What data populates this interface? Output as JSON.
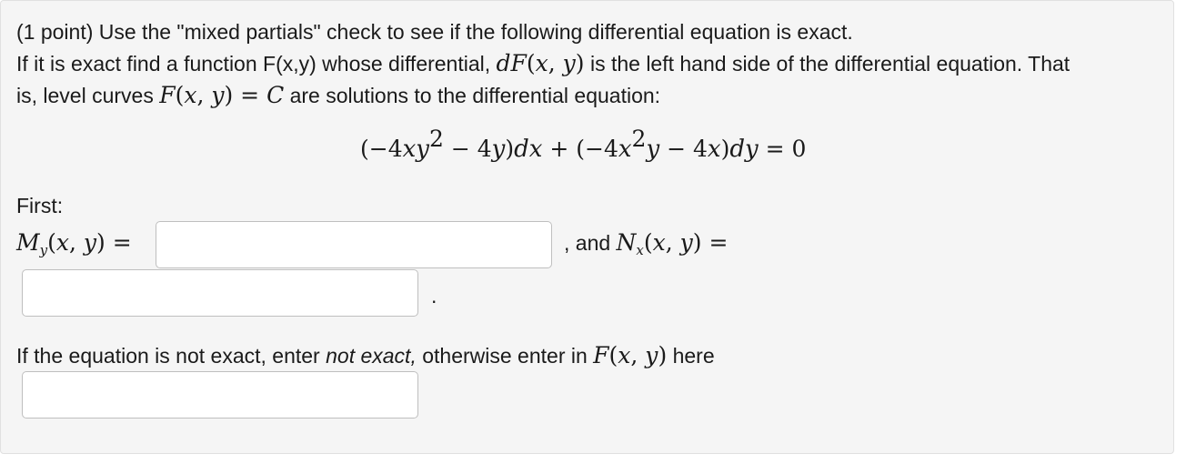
{
  "problem": {
    "line1": "(1 point) Use the \"mixed partials\" check to see if the following differential equation is exact.",
    "line2_a": "If it is exact find a function F(x,y) whose differential,",
    "line2_b": "is the left hand side of the differential equation. That",
    "line3_a": "is, level curves",
    "line3_b": "are solutions to the differential equation:"
  },
  "first_label": "First:",
  "and_text": ", and",
  "period": ".",
  "instruction": {
    "part1": "If the equation is not exact, enter",
    "emphasis": "not exact,",
    "part2": "otherwise enter in",
    "part3": "here"
  },
  "inputs": {
    "my_value": "",
    "nx_value": "",
    "f_value": ""
  }
}
